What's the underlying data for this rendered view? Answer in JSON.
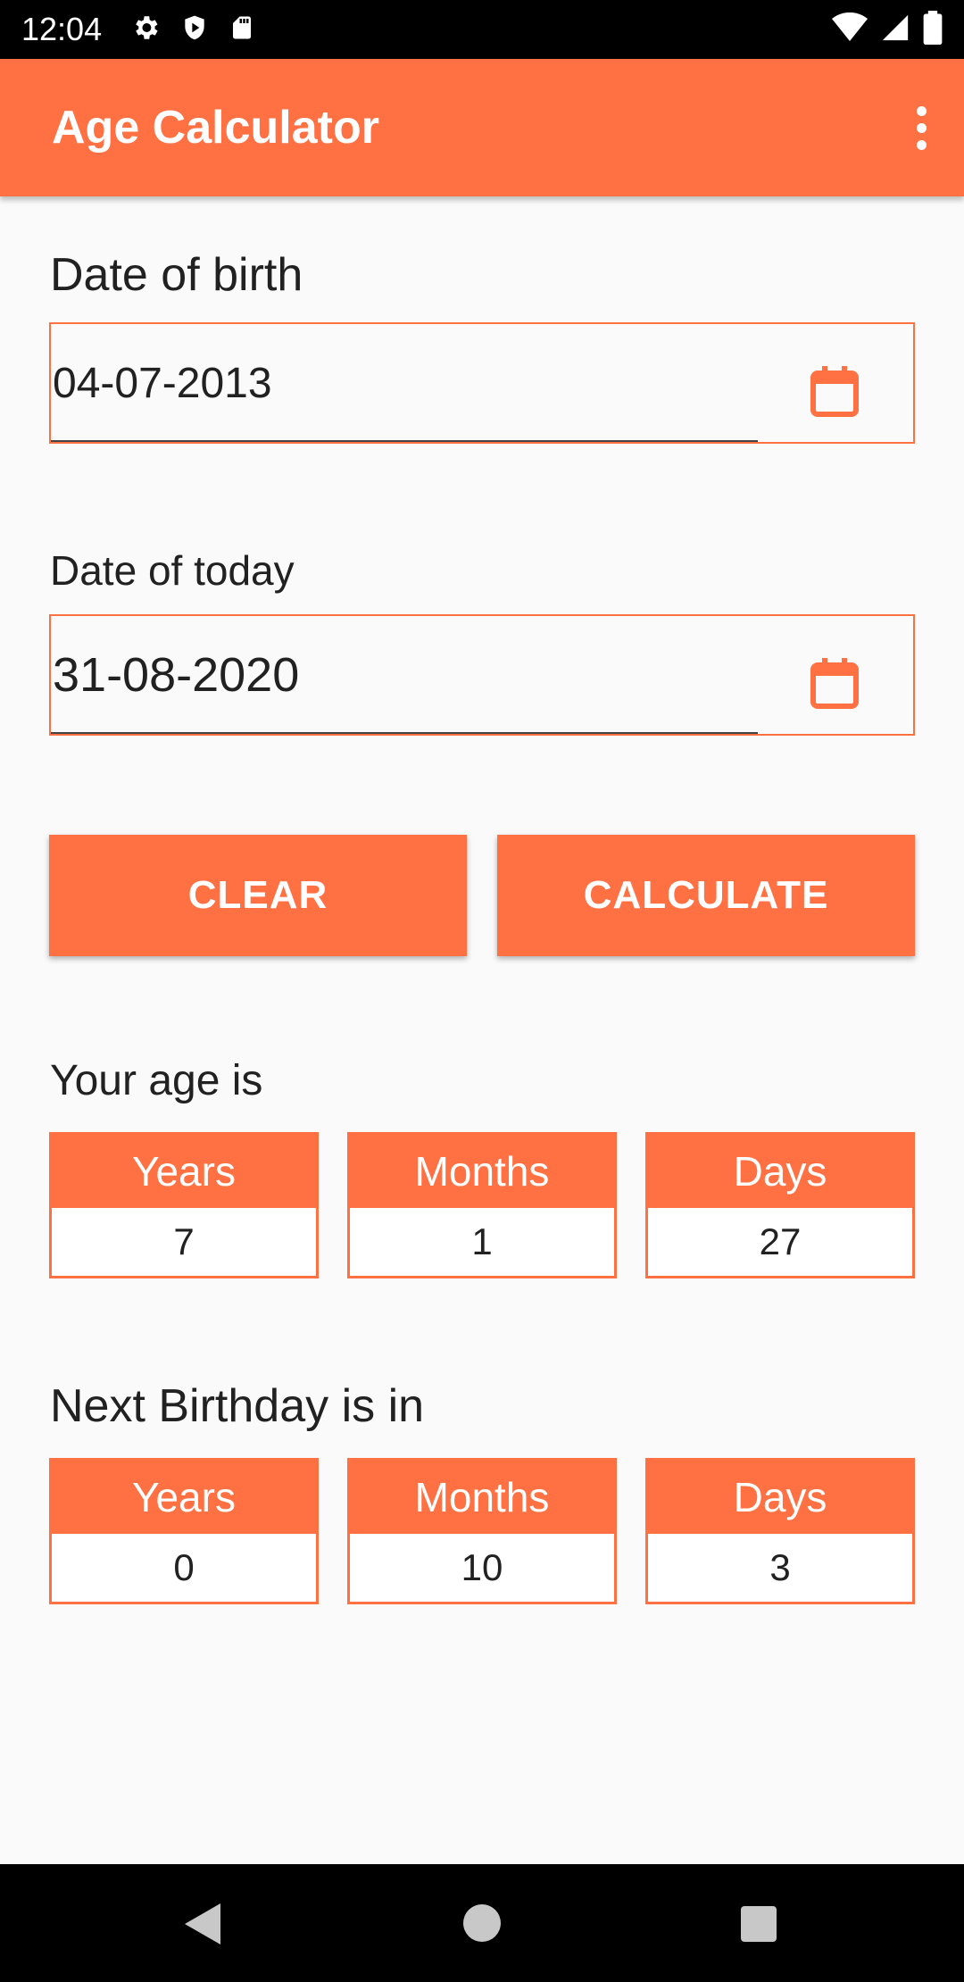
{
  "status_bar": {
    "time": "12:04",
    "left_icons": [
      "settings-icon",
      "shield-icon",
      "sd-card-icon"
    ],
    "right_icons": [
      "wifi-icon",
      "signal-icon",
      "battery-icon"
    ]
  },
  "app_bar": {
    "title": "Age Calculator",
    "menu_icon": "more-vert-icon"
  },
  "colors": {
    "accent": "#ff7043",
    "background": "#fafafa",
    "text": "#212121"
  },
  "birth": {
    "label": "Date of birth",
    "value": "04-07-2013",
    "icon": "calendar-icon"
  },
  "today": {
    "label": "Date of today",
    "value": "31-08-2020",
    "icon": "calendar-icon"
  },
  "buttons": {
    "clear": "CLEAR",
    "calculate": "CALCULATE"
  },
  "age": {
    "label": "Your age is",
    "years_header": "Years",
    "months_header": "Months",
    "days_header": "Days",
    "years": "7",
    "months": "1",
    "days": "27"
  },
  "next_birthday": {
    "label": "Next Birthday is in",
    "years_header": "Years",
    "months_header": "Months",
    "days_header": "Days",
    "years": "0",
    "months": "10",
    "days": "3"
  },
  "nav_bar": {
    "icons": [
      "back-icon",
      "home-icon",
      "recents-icon"
    ]
  }
}
